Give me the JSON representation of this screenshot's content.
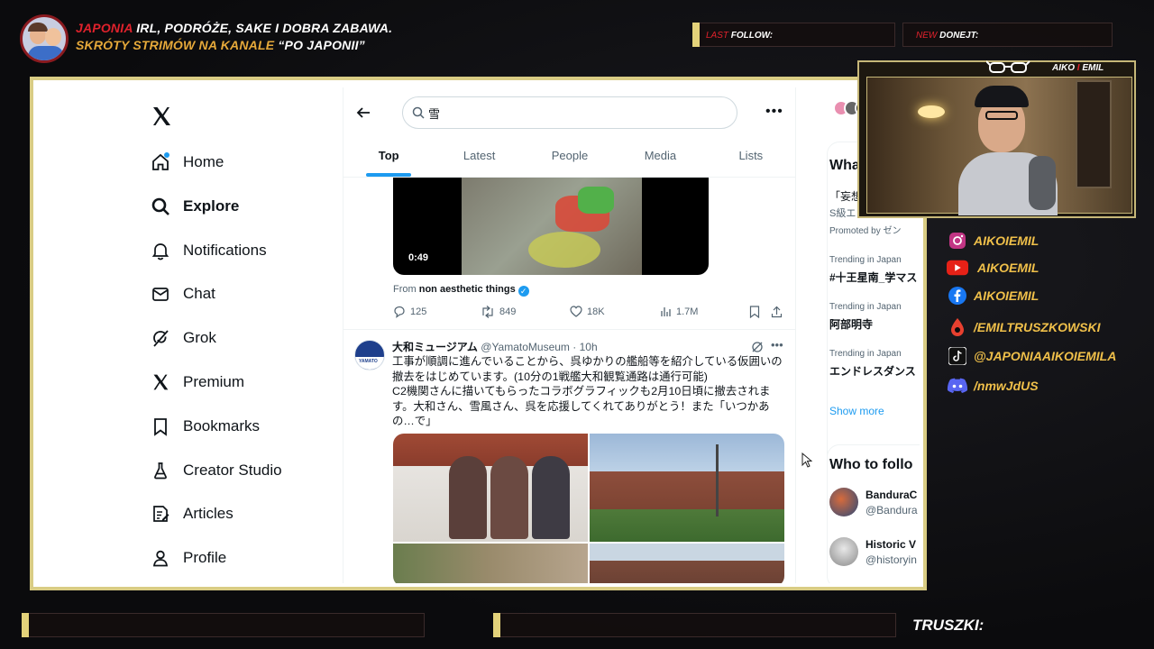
{
  "overlay": {
    "title_red": "JAPONIA",
    "title_rest": " IRL, PODRÓŻE, SAKE I DOBRA ZABAWA.",
    "subtitle_gold": "SKRÓTY STRIMÓW NA KANALE ",
    "subtitle_white": "“PO JAPONII”",
    "last_follow_prefix": "LAST",
    "last_follow_label": " FOLLOW:",
    "new_donejt_prefix": "NEW",
    "new_donejt_label": " DONEJT:",
    "cam_label_1": "AIKO ",
    "cam_label_sep": "I",
    "cam_label_2": " EMIL",
    "truszki": "TRUSZKI:",
    "socials": [
      {
        "icon": "instagram-icon",
        "text": "AIKOIEMIL"
      },
      {
        "icon": "youtube-icon",
        "text": "AIKOEMIL"
      },
      {
        "icon": "facebook-icon",
        "text": "AIKOIEMIL"
      },
      {
        "icon": "drop-icon",
        "text": "/EMILTRUSZKOWSKI"
      },
      {
        "icon": "tiktok-icon",
        "text": "@JAPONIAAIKOIEMILA"
      },
      {
        "icon": "discord-icon",
        "text": "/nmwJdUS"
      }
    ]
  },
  "x": {
    "nav": [
      {
        "label": "Home",
        "icon": "home-icon"
      },
      {
        "label": "Explore",
        "icon": "search-icon"
      },
      {
        "label": "Notifications",
        "icon": "bell-icon"
      },
      {
        "label": "Chat",
        "icon": "mail-icon"
      },
      {
        "label": "Grok",
        "icon": "grok-icon"
      },
      {
        "label": "Premium",
        "icon": "x-logo-icon"
      },
      {
        "label": "Bookmarks",
        "icon": "bookmark-icon"
      },
      {
        "label": "Creator Studio",
        "icon": "flask-icon"
      },
      {
        "label": "Articles",
        "icon": "article-icon"
      },
      {
        "label": "Profile",
        "icon": "person-icon"
      }
    ],
    "search_value": "雪",
    "tabs": [
      "Top",
      "Latest",
      "People",
      "Media",
      "Lists"
    ],
    "video": {
      "duration": "0:49",
      "from_prefix": "From ",
      "from_account": "non aesthetic things",
      "replies": "125",
      "reposts": "849",
      "likes": "18K",
      "views": "1.7M"
    },
    "post": {
      "name": "大和ミュージアム",
      "handle": "@YamatoMuseum",
      "time": "· 10h",
      "text_1": "工事が順調に進んでいることから、呉ゆかりの艦船等を紹介している仮囲いの撤去をはじめています。(10分の1戦艦大和観覧通路は通行可能)",
      "text_2": "C2機関さんに描いてもらったコラボグラフィックも2月10日頃に撤去されます。大和さん、雪風さん、呉を応援してくれてありがとう！また「いつかあの…で」"
    },
    "right": {
      "whats": "What",
      "promo_1": "「妄想",
      "promo_2": "S級エ",
      "promo_3": "Promoted by ゼン",
      "trends": [
        {
          "category": "Trending in Japan",
          "name": "#十王星南_学マス"
        },
        {
          "category": "Trending in Japan",
          "name": "阿部明寺"
        },
        {
          "category": "Trending in Japan",
          "name": "エンドレスダンス"
        }
      ],
      "show_more": "Show more",
      "who_title": "Who to follo",
      "who": [
        {
          "name": "BanduraC",
          "handle": "@Bandura"
        },
        {
          "name": "Historic V",
          "handle": "@historyin"
        }
      ]
    }
  }
}
